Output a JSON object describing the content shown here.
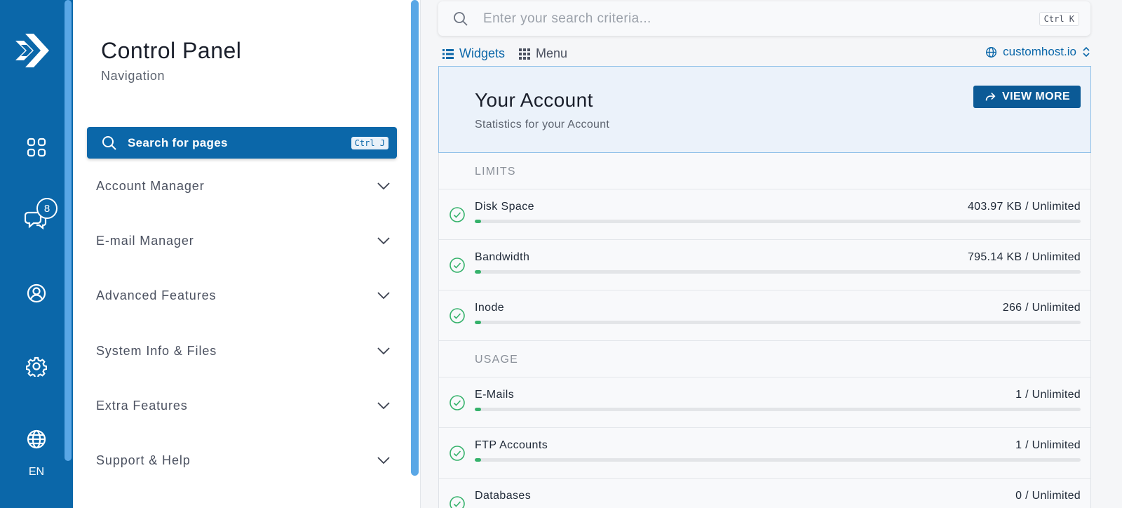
{
  "rail": {
    "logo_icon": "brand-arrow-logo",
    "items": [
      {
        "icon": "dashboard-grid-icon"
      },
      {
        "icon": "chat-icon",
        "badge": "8"
      },
      {
        "icon": "user-circle-icon"
      },
      {
        "icon": "gear-icon"
      },
      {
        "icon": "globe-icon"
      }
    ],
    "language": "EN"
  },
  "nav": {
    "title": "Control Panel",
    "subtitle": "Navigation",
    "search_label": "Search for pages",
    "search_shortcut": "Ctrl J",
    "items": [
      {
        "label": "Account Manager"
      },
      {
        "label": "E-mail Manager"
      },
      {
        "label": "Advanced Features"
      },
      {
        "label": "System Info & Files"
      },
      {
        "label": "Extra Features"
      },
      {
        "label": "Support & Help"
      }
    ]
  },
  "search": {
    "placeholder": "Enter your search criteria...",
    "shortcut": "Ctrl K"
  },
  "tabs": [
    {
      "label": "Widgets",
      "active": true
    },
    {
      "label": "Menu",
      "active": false
    }
  ],
  "domain": "customhost.io",
  "account": {
    "title": "Your Account",
    "subtitle": "Statistics for your Account",
    "view_more": "VIEW MORE",
    "sections": [
      {
        "label": "LIMITS",
        "rows": [
          {
            "name": "Disk Space",
            "value": "403.97 KB / Unlimited",
            "progress": 0.01
          },
          {
            "name": "Bandwidth",
            "value": "795.14 KB / Unlimited",
            "progress": 0.01
          },
          {
            "name": "Inode",
            "value": "266 / Unlimited",
            "progress": 0.01
          }
        ]
      },
      {
        "label": "USAGE",
        "rows": [
          {
            "name": "E-Mails",
            "value": "1 / Unlimited",
            "progress": 0.01
          },
          {
            "name": "FTP Accounts",
            "value": "1 / Unlimited",
            "progress": 0.01
          },
          {
            "name": "Databases",
            "value": "0 / Unlimited",
            "progress": 0.01
          }
        ]
      }
    ]
  },
  "colors": {
    "brand": "#0b67a9",
    "success": "#35b26b",
    "header_bg": "#ebf2fa"
  }
}
